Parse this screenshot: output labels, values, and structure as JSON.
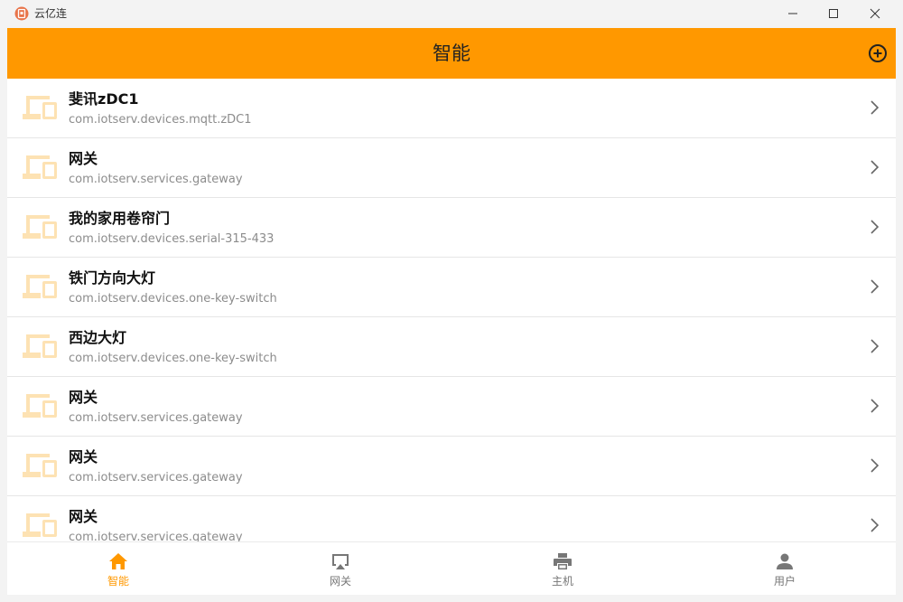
{
  "window": {
    "title": "云亿连"
  },
  "appbar": {
    "title": "智能",
    "add_icon": "plus-circle-icon"
  },
  "colors": {
    "accent": "#ff9800",
    "device_icon": "#fde2b3",
    "text_primary": "#111111",
    "text_secondary": "#8c8c8c"
  },
  "devices": [
    {
      "name": "斐讯zDC1",
      "id": "com.iotserv.devices.mqtt.zDC1"
    },
    {
      "name": "网关",
      "id": "com.iotserv.services.gateway"
    },
    {
      "name": "我的家用卷帘门",
      "id": "com.iotserv.devices.serial-315-433"
    },
    {
      "name": "铁门方向大灯",
      "id": "com.iotserv.devices.one-key-switch"
    },
    {
      "name": "西边大灯",
      "id": "com.iotserv.devices.one-key-switch"
    },
    {
      "name": "网关",
      "id": "com.iotserv.services.gateway"
    },
    {
      "name": "网关",
      "id": "com.iotserv.services.gateway"
    },
    {
      "name": "网关",
      "id": "com.iotserv.services.gateway"
    }
  ],
  "nav": {
    "items": [
      {
        "label": "智能",
        "icon": "home-icon",
        "active": true
      },
      {
        "label": "网关",
        "icon": "airplay-icon",
        "active": false
      },
      {
        "label": "主机",
        "icon": "printer-icon",
        "active": false
      },
      {
        "label": "用户",
        "icon": "person-icon",
        "active": false
      }
    ]
  }
}
